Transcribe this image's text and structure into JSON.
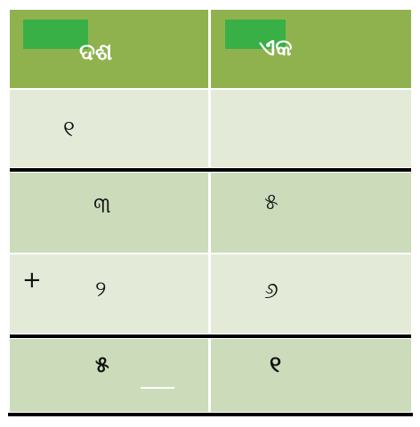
{
  "headers": {
    "tens": "ଦଶ",
    "ones": "ଏକ"
  },
  "carry": {
    "tens": "୧",
    "ones": ""
  },
  "first_number": {
    "tens": "୩",
    "ones": "୫"
  },
  "operator": "+",
  "second_number": {
    "tens": "୨",
    "ones": "୬"
  },
  "result": {
    "tens": "୫",
    "ones": "୧"
  },
  "colors": {
    "header_bg": "#8fb24f",
    "header_mark": "#38b046",
    "row_light": "#e3ead8",
    "row_mid": "#ccdcbb"
  }
}
